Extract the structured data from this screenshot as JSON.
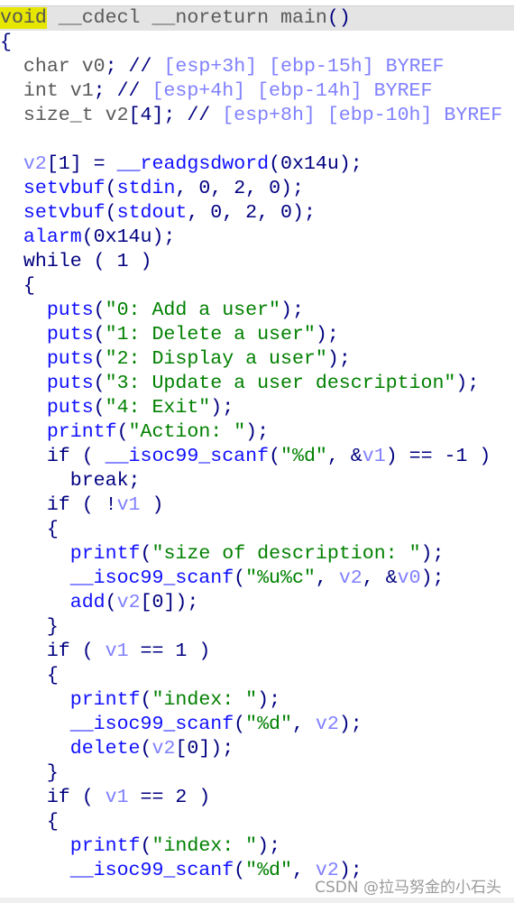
{
  "watermark": "CSDN @拉马努金的小石头",
  "colors": {
    "punctuation": "#000080",
    "function": "#1010ff",
    "variable": "#8080ff",
    "string": "#008000",
    "type": "#5a5a5a",
    "highlight": "#e6e600"
  },
  "code_lines": [
    [
      [
        "hl",
        "void"
      ],
      [
        "g",
        " __cdecl __noreturn main"
      ],
      [
        "p",
        "()"
      ]
    ],
    [
      [
        "p",
        "{"
      ]
    ],
    [
      [
        "g",
        "  char v0"
      ],
      [
        "p",
        "; //"
      ],
      [
        "c",
        " [esp+3h] [ebp-15h] BYREF"
      ]
    ],
    [
      [
        "g",
        "  int v1"
      ],
      [
        "p",
        "; //"
      ],
      [
        "c",
        " [esp+4h] [ebp-14h] BYREF"
      ]
    ],
    [
      [
        "g",
        "  size_t v2"
      ],
      [
        "p",
        "[4]; //"
      ],
      [
        "c",
        " [esp+8h] [ebp-10h] BYREF"
      ]
    ],
    [],
    [
      [
        "v",
        "  v2"
      ],
      [
        "p",
        "[1] = "
      ],
      [
        "f",
        "__readgsdword"
      ],
      [
        "p",
        "(0x14u);"
      ]
    ],
    [
      [
        "f",
        "  setvbuf"
      ],
      [
        "p",
        "("
      ],
      [
        "f",
        "stdin"
      ],
      [
        "p",
        ", 0, 2, 0);"
      ]
    ],
    [
      [
        "f",
        "  setvbuf"
      ],
      [
        "p",
        "("
      ],
      [
        "f",
        "stdout"
      ],
      [
        "p",
        ", 0, 2, 0);"
      ]
    ],
    [
      [
        "f",
        "  alarm"
      ],
      [
        "p",
        "(0x14u);"
      ]
    ],
    [
      [
        "p",
        "  while ( 1 )"
      ]
    ],
    [
      [
        "p",
        "  {"
      ]
    ],
    [
      [
        "f",
        "    puts"
      ],
      [
        "p",
        "("
      ],
      [
        "s",
        "\"0: Add a user\""
      ],
      [
        "p",
        ");"
      ]
    ],
    [
      [
        "f",
        "    puts"
      ],
      [
        "p",
        "("
      ],
      [
        "s",
        "\"1: Delete a user\""
      ],
      [
        "p",
        ");"
      ]
    ],
    [
      [
        "f",
        "    puts"
      ],
      [
        "p",
        "("
      ],
      [
        "s",
        "\"2: Display a user\""
      ],
      [
        "p",
        ");"
      ]
    ],
    [
      [
        "f",
        "    puts"
      ],
      [
        "p",
        "("
      ],
      [
        "s",
        "\"3: Update a user description\""
      ],
      [
        "p",
        ");"
      ]
    ],
    [
      [
        "f",
        "    puts"
      ],
      [
        "p",
        "("
      ],
      [
        "s",
        "\"4: Exit\""
      ],
      [
        "p",
        ");"
      ]
    ],
    [
      [
        "f",
        "    printf"
      ],
      [
        "p",
        "("
      ],
      [
        "s",
        "\"Action: \""
      ],
      [
        "p",
        ");"
      ]
    ],
    [
      [
        "p",
        "    if ( "
      ],
      [
        "f",
        "__isoc99_scanf"
      ],
      [
        "p",
        "("
      ],
      [
        "s",
        "\"%d\""
      ],
      [
        "p",
        ", &"
      ],
      [
        "v",
        "v1"
      ],
      [
        "p",
        ") == -1 )"
      ]
    ],
    [
      [
        "p",
        "      break;"
      ]
    ],
    [
      [
        "p",
        "    if ( !"
      ],
      [
        "v",
        "v1"
      ],
      [
        "p",
        " )"
      ]
    ],
    [
      [
        "p",
        "    {"
      ]
    ],
    [
      [
        "f",
        "      printf"
      ],
      [
        "p",
        "("
      ],
      [
        "s",
        "\"size of description: \""
      ],
      [
        "p",
        ");"
      ]
    ],
    [
      [
        "f",
        "      __isoc99_scanf"
      ],
      [
        "p",
        "("
      ],
      [
        "s",
        "\"%u%c\""
      ],
      [
        "p",
        ", "
      ],
      [
        "v",
        "v2"
      ],
      [
        "p",
        ", &"
      ],
      [
        "v",
        "v0"
      ],
      [
        "p",
        ");"
      ]
    ],
    [
      [
        "f",
        "      add"
      ],
      [
        "p",
        "("
      ],
      [
        "v",
        "v2"
      ],
      [
        "p",
        "[0]);"
      ]
    ],
    [
      [
        "p",
        "    }"
      ]
    ],
    [
      [
        "p",
        "    if ( "
      ],
      [
        "v",
        "v1"
      ],
      [
        "p",
        " == 1 )"
      ]
    ],
    [
      [
        "p",
        "    {"
      ]
    ],
    [
      [
        "f",
        "      printf"
      ],
      [
        "p",
        "("
      ],
      [
        "s",
        "\"index: \""
      ],
      [
        "p",
        ");"
      ]
    ],
    [
      [
        "f",
        "      __isoc99_scanf"
      ],
      [
        "p",
        "("
      ],
      [
        "s",
        "\"%d\""
      ],
      [
        "p",
        ", "
      ],
      [
        "v",
        "v2"
      ],
      [
        "p",
        ");"
      ]
    ],
    [
      [
        "f",
        "      delete"
      ],
      [
        "p",
        "("
      ],
      [
        "v",
        "v2"
      ],
      [
        "p",
        "[0]);"
      ]
    ],
    [
      [
        "p",
        "    }"
      ]
    ],
    [
      [
        "p",
        "    if ( "
      ],
      [
        "v",
        "v1"
      ],
      [
        "p",
        " == 2 )"
      ]
    ],
    [
      [
        "p",
        "    {"
      ]
    ],
    [
      [
        "f",
        "      printf"
      ],
      [
        "p",
        "("
      ],
      [
        "s",
        "\"index: \""
      ],
      [
        "p",
        ");"
      ]
    ],
    [
      [
        "f",
        "      __isoc99_scanf"
      ],
      [
        "p",
        "("
      ],
      [
        "s",
        "\"%d\""
      ],
      [
        "p",
        ", "
      ],
      [
        "v",
        "v2"
      ],
      [
        "p",
        ");"
      ]
    ]
  ]
}
